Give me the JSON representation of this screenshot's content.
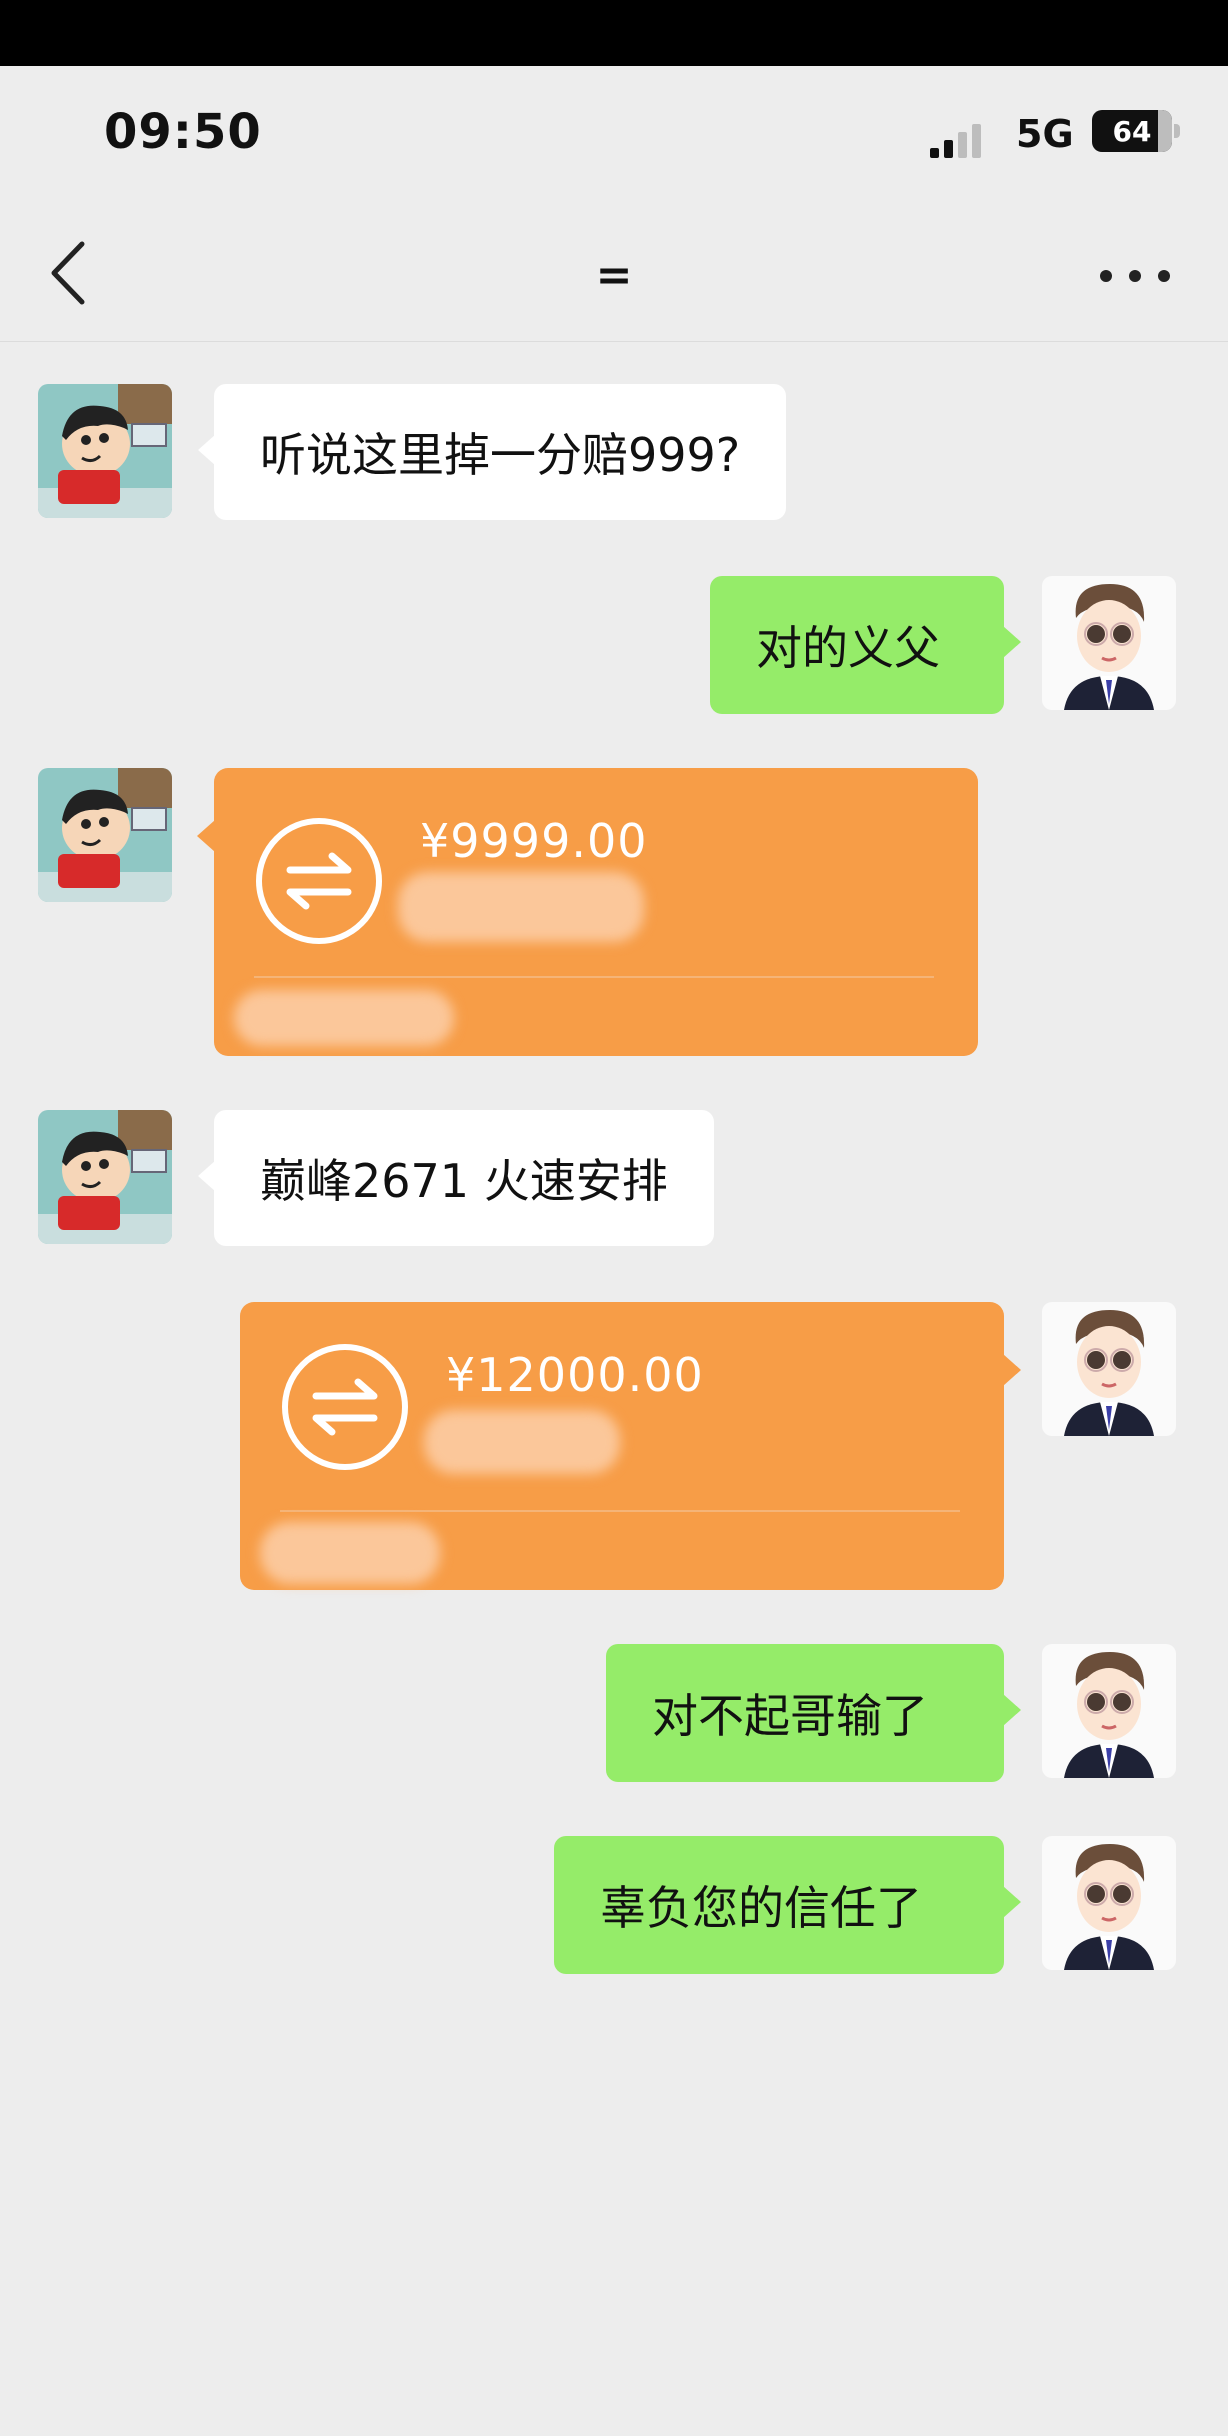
{
  "status_bar": {
    "time": "09:50",
    "network": "5G",
    "battery": "64"
  },
  "nav": {
    "title": "=",
    "back_icon": "chevron-left-icon",
    "more_icon": "more-horizontal-icon"
  },
  "messages": [
    {
      "side": "left",
      "type": "text",
      "text": "听说这里掉一分赔999?"
    },
    {
      "side": "right",
      "type": "text",
      "text": "对的义父"
    },
    {
      "side": "left",
      "type": "transfer",
      "amount": "¥9999.00",
      "icon": "transfer-arrows-icon"
    },
    {
      "side": "left",
      "type": "text",
      "text": "巅峰2671 火速安排"
    },
    {
      "side": "right",
      "type": "transfer",
      "amount": "¥12000.00",
      "icon": "transfer-arrows-icon"
    },
    {
      "side": "right",
      "type": "text",
      "text": "对不起哥输了"
    },
    {
      "side": "right",
      "type": "text",
      "text": "辜负您的信任了"
    }
  ],
  "colors": {
    "background": "#ededed",
    "green_bubble": "#95ec69",
    "white_bubble": "#ffffff",
    "transfer_orange": "#f79d47"
  }
}
